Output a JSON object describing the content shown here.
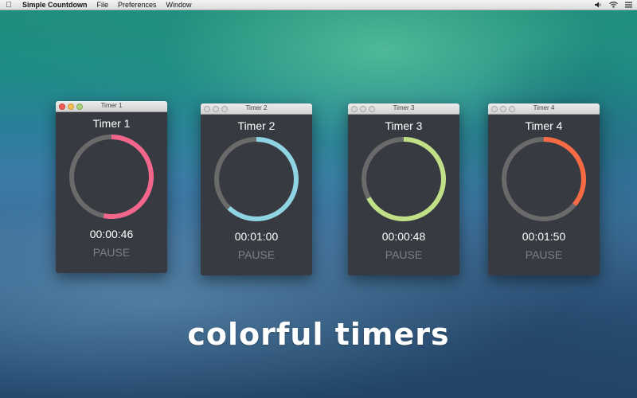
{
  "menubar": {
    "apple_icon": "apple-logo",
    "app_name": "Simple Countdown",
    "items": [
      "File",
      "Preferences",
      "Window"
    ],
    "status_icons": [
      "volume-icon",
      "wifi-icon",
      "list-icon"
    ]
  },
  "timers": [
    {
      "window_title": "Timer 1",
      "name": "Timer 1",
      "time": "00:00:46",
      "button": "PAUSE",
      "color": "#f2668b",
      "progress": 0.53,
      "active": true
    },
    {
      "window_title": "Timer 2",
      "name": "Timer 2",
      "time": "00:01:00",
      "button": "PAUSE",
      "color": "#8fd4e3",
      "progress": 0.62,
      "active": false
    },
    {
      "window_title": "Timer 3",
      "name": "Timer 3",
      "time": "00:00:48",
      "button": "PAUSE",
      "color": "#bfe086",
      "progress": 0.67,
      "active": false
    },
    {
      "window_title": "Timer 4",
      "name": "Timer 4",
      "time": "00:01:50",
      "button": "PAUSE",
      "color": "#f76a44",
      "progress": 0.36,
      "active": false
    }
  ],
  "tagline": "colorful timers"
}
